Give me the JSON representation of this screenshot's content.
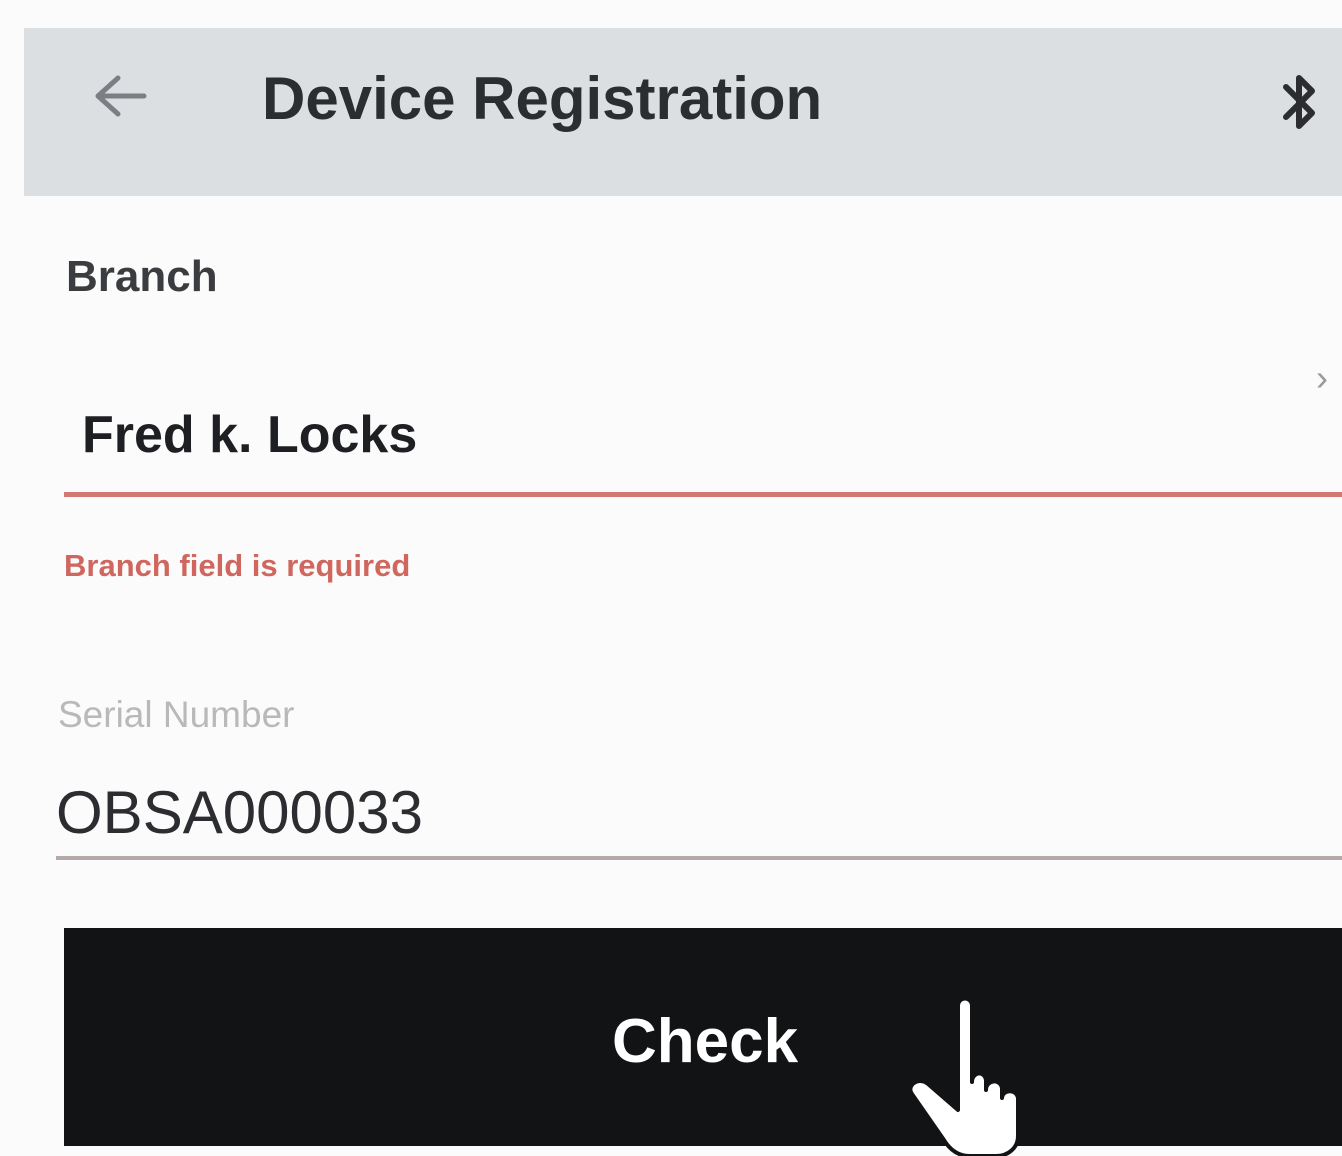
{
  "header": {
    "title": "Device Registration",
    "back_icon": "back-arrow-icon",
    "bluetooth_icon": "bluetooth-icon",
    "background_color": "#dcdfe1"
  },
  "form": {
    "branch": {
      "label": "Branch",
      "value": "Fred k. Locks",
      "error": "Branch field is required",
      "chevron": "›",
      "error_color": "#d0675f"
    },
    "serial": {
      "label": "Serial Number",
      "value": "OBSA000033"
    },
    "check_button": {
      "label": "Check",
      "background_color": "#111315"
    }
  },
  "cursor": {
    "icon": "hand-pointer-icon"
  }
}
